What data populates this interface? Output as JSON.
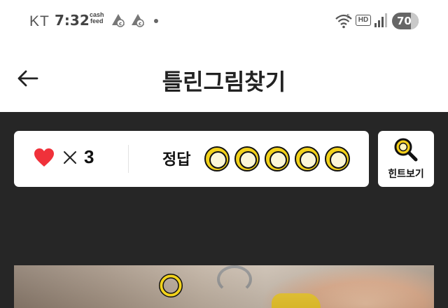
{
  "status_bar": {
    "carrier": "KT",
    "time": "7:32",
    "cash_feed_line1": "cash",
    "cash_feed_line2": "feed",
    "network_label": "HD",
    "wifi_band": "5",
    "battery": "70",
    "battery_level": 0.7
  },
  "header": {
    "title": "틀린그림찾기"
  },
  "game": {
    "lives": "3",
    "answer_label": "정답",
    "answers_total": 5,
    "answers_found": 0,
    "hint_label": "힌트보기"
  },
  "colors": {
    "heart": "#f0313a",
    "slot_ring": "#f2d21b",
    "game_background": "#262626",
    "hint_icon": "#f5cf1a"
  },
  "icons": [
    "back-arrow-icon",
    "heart-icon",
    "times-icon",
    "answer-slot-icon",
    "magnifier-icon",
    "found-marker-icon"
  ]
}
